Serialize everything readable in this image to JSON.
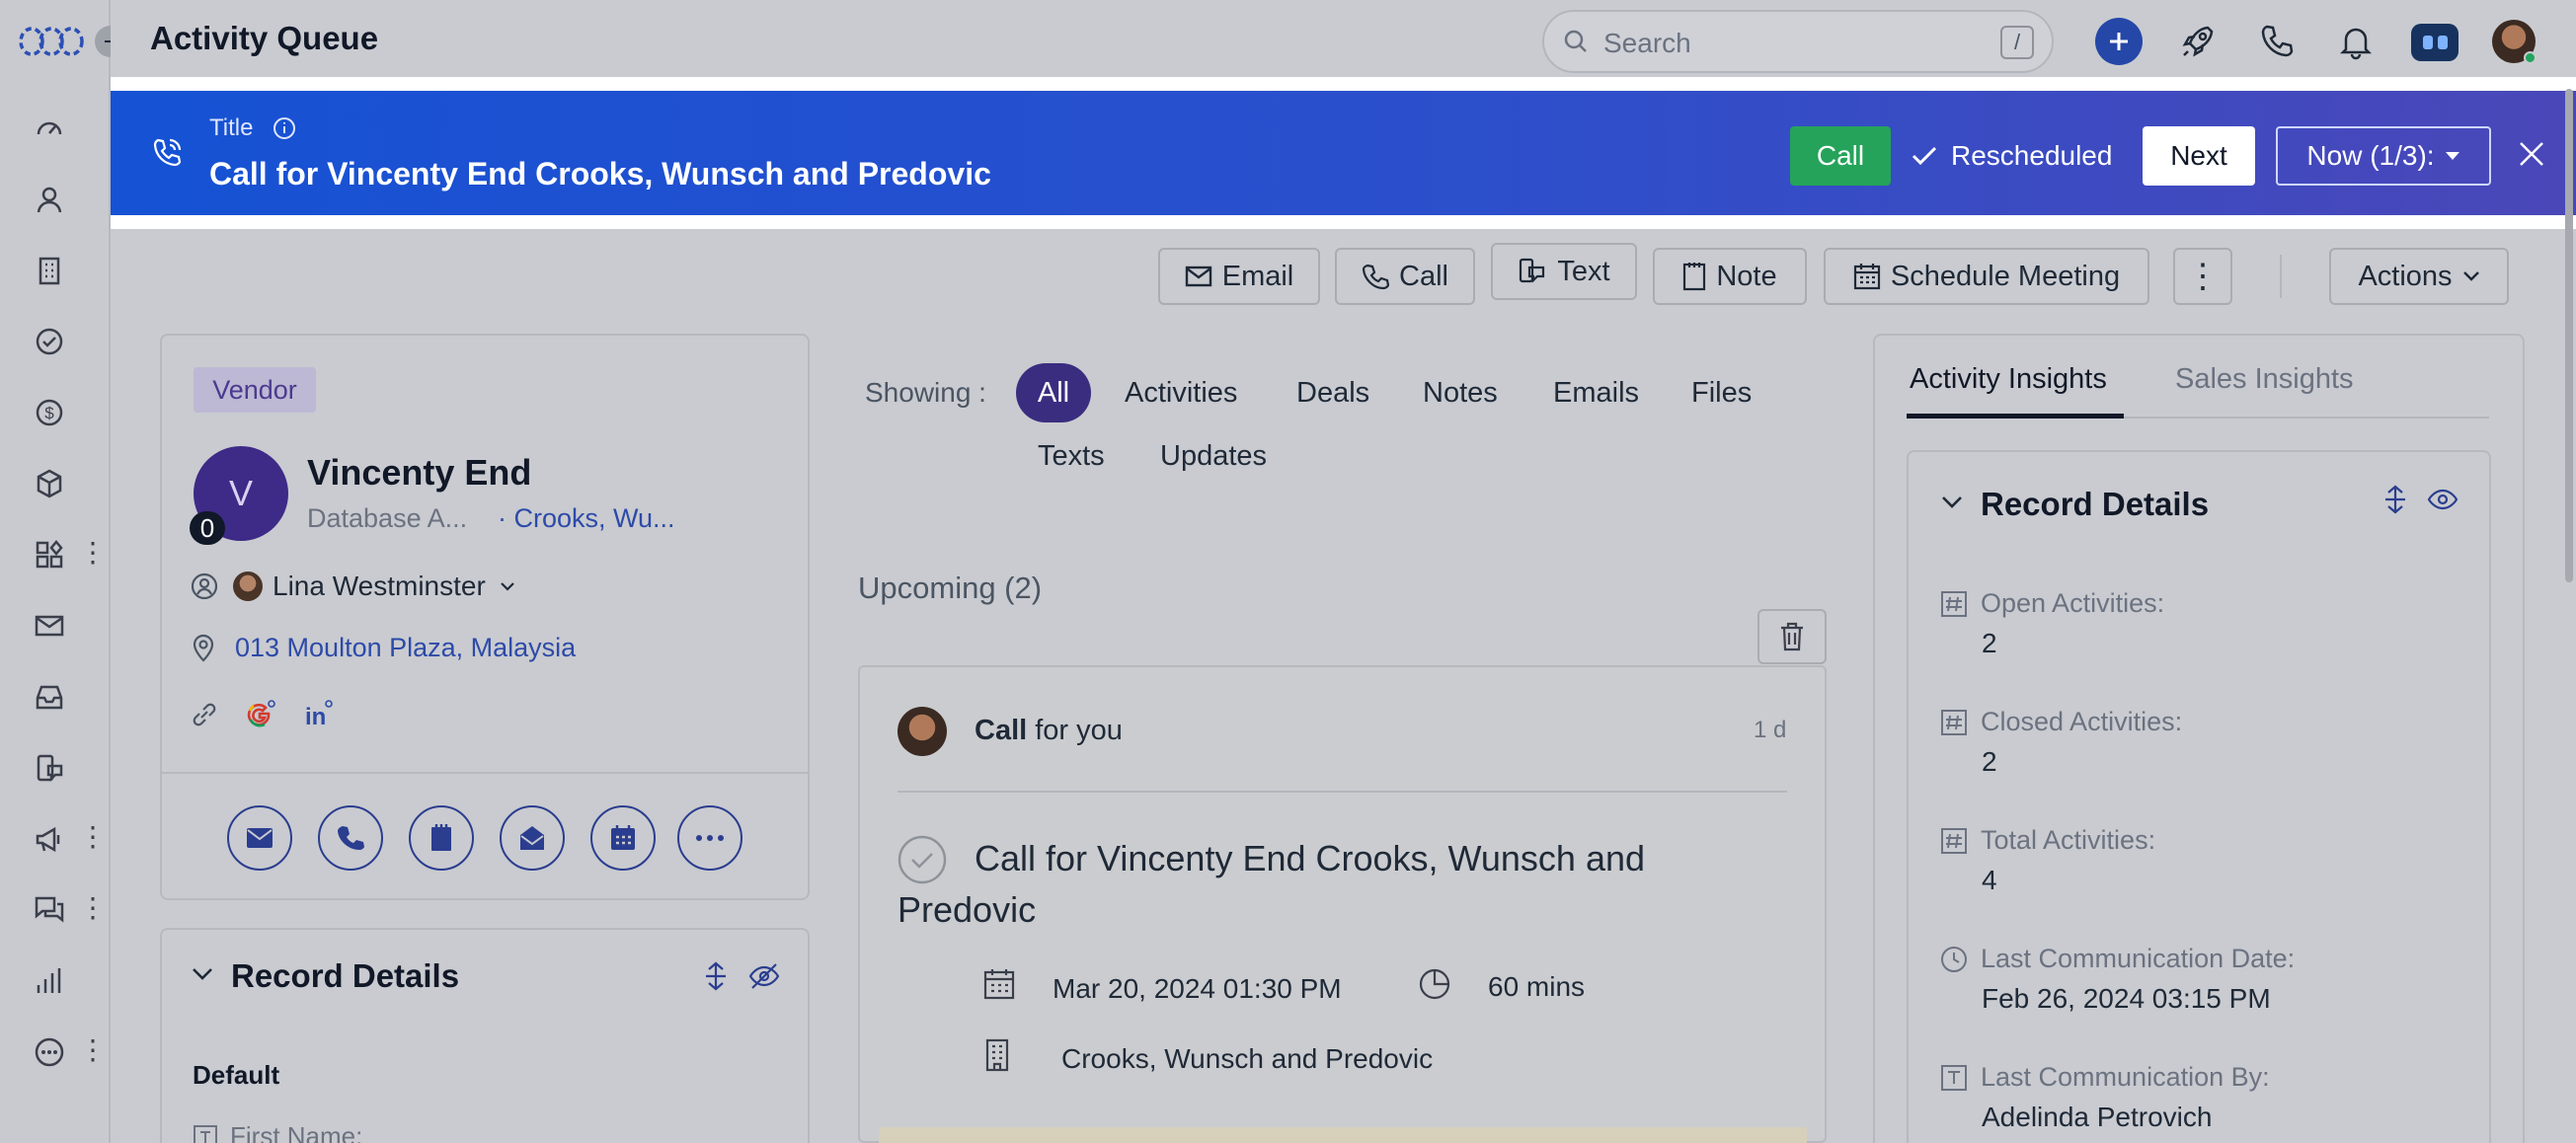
{
  "header": {
    "page_title": "Activity Queue",
    "search_placeholder": "Search",
    "search_shortcut": "/"
  },
  "banner": {
    "label": "Title",
    "title": "Call for Vincenty End Crooks, Wunsch and Predovic",
    "call_button": "Call",
    "rescheduled": "Rescheduled",
    "next_button": "Next",
    "now_dropdown": "Now (1/3):"
  },
  "actions_row": {
    "email": "Email",
    "call": "Call",
    "text": "Text",
    "note": "Note",
    "schedule": "Schedule Meeting",
    "actions": "Actions"
  },
  "record": {
    "badge": "Vendor",
    "avatar_initial": "V",
    "avatar_count": "0",
    "name": "Vincenty End",
    "subtitle": "Database A...",
    "company": "· Crooks, Wu...",
    "owner": "Lina Westminster",
    "address": "013 Moulton Plaza, Malaysia"
  },
  "record_details": {
    "title": "Record Details",
    "section": "Default",
    "first_field": "First Name:"
  },
  "timeline": {
    "showing_label": "Showing :",
    "filters": [
      "All",
      "Activities",
      "Deals",
      "Notes",
      "Emails",
      "Files",
      "Texts",
      "Updates"
    ],
    "upcoming": "Upcoming (2)",
    "activity": {
      "type": "Call",
      "for": "for you",
      "age": "1 d",
      "title": "Call for Vincenty End Crooks, Wunsch and Predovic",
      "date": "Mar 20, 2024 01:30 PM",
      "duration": "60 mins",
      "company": "Crooks, Wunsch and Predovic"
    }
  },
  "insights": {
    "tabs": [
      "Activity Insights",
      "Sales Insights"
    ],
    "title": "Record Details",
    "fields": [
      {
        "label": "Open Activities:",
        "value": "2"
      },
      {
        "label": "Closed Activities:",
        "value": "2"
      },
      {
        "label": "Total Activities:",
        "value": "4"
      },
      {
        "label": "Last Communication Date:",
        "value": "Feb 26, 2024 03:15 PM"
      },
      {
        "label": "Last Communication By:",
        "value": "Adelinda Petrovich"
      }
    ]
  },
  "colors": {
    "banner_start": "#1552d4",
    "banner_end": "#4a47b8",
    "call_green": "#25a35a",
    "accent_purple": "#3a2d80",
    "link_blue": "#2d4aa8"
  }
}
